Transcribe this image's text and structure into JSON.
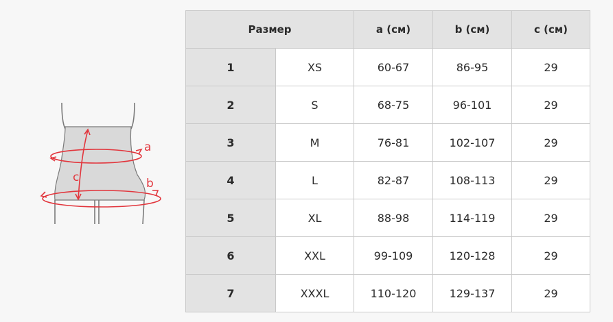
{
  "diagram": {
    "labels": {
      "a": "a",
      "b": "b",
      "c": "c"
    },
    "accent_color": "#e2363d",
    "belt_color": "#d9d9d9"
  },
  "table": {
    "headers": [
      "Размер",
      "a (см)",
      "b (см)",
      "c (см)"
    ],
    "rows": [
      [
        "1",
        "XS",
        "60-67",
        "86-95",
        "29"
      ],
      [
        "2",
        "S",
        "68-75",
        "96-101",
        "29"
      ],
      [
        "3",
        "M",
        "76-81",
        "102-107",
        "29"
      ],
      [
        "4",
        "L",
        "82-87",
        "108-113",
        "29"
      ],
      [
        "5",
        "XL",
        "88-98",
        "114-119",
        "29"
      ],
      [
        "6",
        "XXL",
        "99-109",
        "120-128",
        "29"
      ],
      [
        "7",
        "XXXL",
        "110-120",
        "129-137",
        "29"
      ]
    ]
  }
}
